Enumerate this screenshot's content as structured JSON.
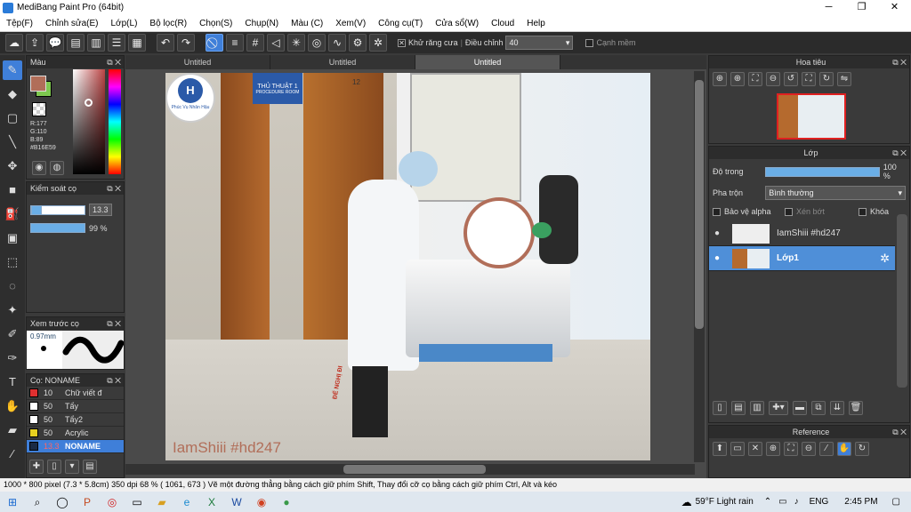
{
  "window": {
    "title": "MediBang Paint Pro (64bit)",
    "btn_min": "─",
    "btn_max": "❐",
    "btn_close": "✕"
  },
  "menu": [
    "Tệp(F)",
    "Chỉnh sửa(E)",
    "Lớp(L)",
    "Bộ lọc(R)",
    "Chọn(S)",
    "Chụp(N)",
    "Màu (C)",
    "Xem(V)",
    "Công cụ(T)",
    "Cửa sổ(W)",
    "Cloud",
    "Help"
  ],
  "toolbar": {
    "antialias_label": "Khử răng cưa",
    "adjust_label": "Điều chỉnh",
    "adjust_value": "40",
    "smooth_label": "Cạnh mềm",
    "checked_mark": "✕"
  },
  "color_panel": {
    "title": "Màu",
    "r": "R:177",
    "g": "G:110",
    "b": "B:89",
    "hex": "#B16E59",
    "fg_color": "#b16e59",
    "bg_color": "#7ec850"
  },
  "brush_control": {
    "title": "Kiểm soát cọ",
    "size": "13.3",
    "opacity": "99 %",
    "size_fraction": 0.8,
    "opacity_fraction": 0.99
  },
  "brush_preview": {
    "title": "Xem trước cọ",
    "size_label": "0.97mm"
  },
  "brush_list": {
    "title": "Cọ: NONAME",
    "items": [
      {
        "size": "10",
        "name": "Chữ viết đ",
        "color": "#e03030"
      },
      {
        "size": "50",
        "name": "Tẩy",
        "color": "#ffffff"
      },
      {
        "size": "50",
        "name": "Tẩy2",
        "color": "#ffffff"
      },
      {
        "size": "50",
        "name": "Acrylic",
        "color": "#e8d020"
      },
      {
        "size": "13.3",
        "name": "NONAME",
        "color": "#1a2a44"
      }
    ]
  },
  "tabs": [
    "Untitled",
    "Untitled",
    "Untitled"
  ],
  "canvas": {
    "watermark": "IamShiii #hd247",
    "sign_line1": "THỦ THUẬT 1",
    "sign_line2": "PROCEDURE ROOM",
    "room_number": "12",
    "logo_text": "Phúc Vụ Nhân Hậu",
    "floor_text": "ĐỂ NGHỊ ĐI"
  },
  "navigator": {
    "title": "Hoa tiêu"
  },
  "layers": {
    "title": "Lớp",
    "opacity_label": "Độ trong",
    "opacity_value": "100 %",
    "blend_label": "Pha trộn",
    "blend_value": "Bình thường",
    "protect_alpha": "Bảo vệ alpha",
    "clipping": "Xén bớt",
    "lock": "Khóa",
    "items": [
      {
        "name": "IamShiii #hd247",
        "selected": false
      },
      {
        "name": "Lớp1",
        "selected": true
      }
    ]
  },
  "reference": {
    "title": "Reference"
  },
  "status": {
    "text": "1000 * 800 pixel   (7.3 * 5.8cm)   350 dpi   68 %   ( 1061, 673 )   Vẽ một đường thẳng bằng cách giữ phím Shift, Thay đổi cỡ cọ bằng cách giữ phím Ctrl, Alt và kéo"
  },
  "taskbar": {
    "weather": "59°F  Light rain",
    "lang": "ENG",
    "time": "2:45 PM"
  }
}
